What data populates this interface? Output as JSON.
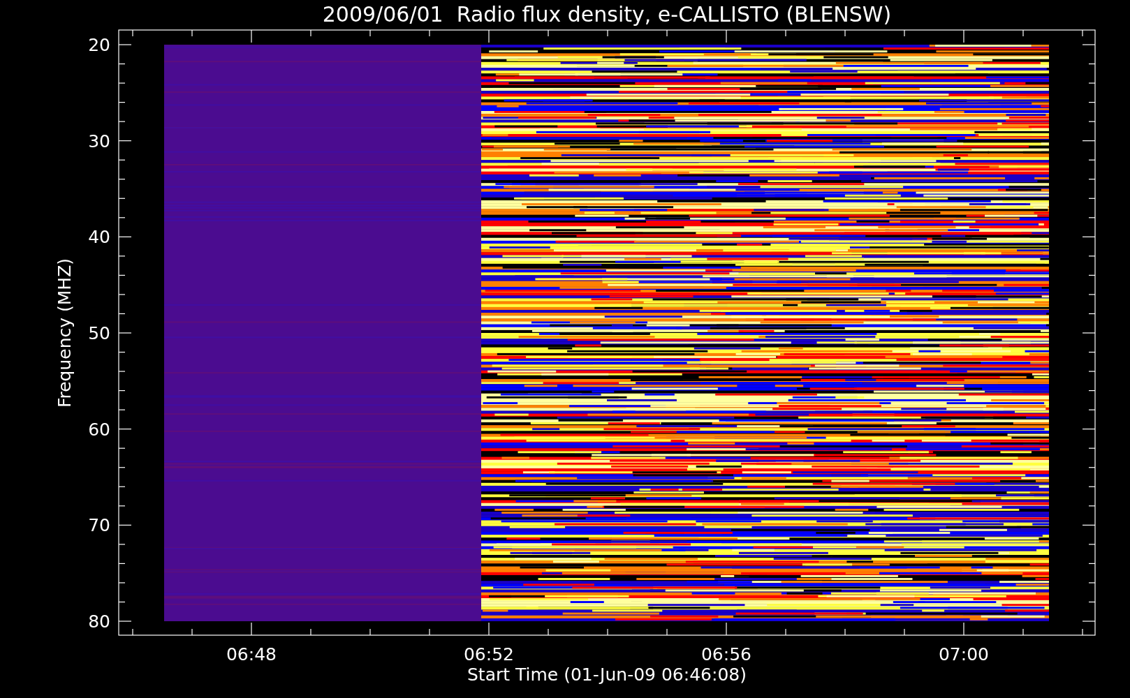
{
  "title": "2009/06/01  Radio flux density, e-CALLISTO (BLENSW)",
  "y_axis": {
    "label": "Frequency (MHZ)",
    "ticks": [
      "20",
      "30",
      "40",
      "50",
      "60",
      "70",
      "80"
    ]
  },
  "x_axis": {
    "label": "Start Time (01-Jun-09 06:46:08)",
    "ticks": [
      "06:48",
      "06:52",
      "06:56",
      "07:00"
    ]
  }
}
